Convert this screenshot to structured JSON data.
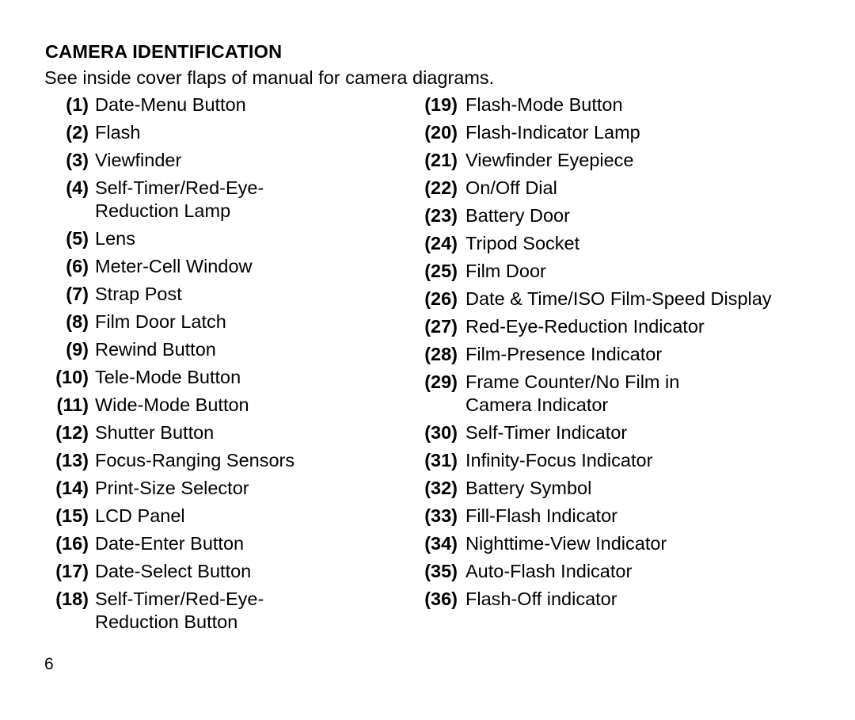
{
  "document": {
    "heading": "CAMERA IDENTIFICATION",
    "subtitle": "See inside cover flaps of manual for camera diagrams.",
    "page_number": "6",
    "text_color": "#000000",
    "background_color": "#ffffff"
  },
  "left_column": {
    "items": [
      {
        "number": "(1)",
        "label": "Date-Menu Button"
      },
      {
        "number": "(2)",
        "label": "Flash"
      },
      {
        "number": "(3)",
        "label": "Viewfinder"
      },
      {
        "number": "(4)",
        "label": "Self-Timer/Red-Eye-\nReduction Lamp"
      },
      {
        "number": "(5)",
        "label": "Lens"
      },
      {
        "number": "(6)",
        "label": "Meter-Cell Window"
      },
      {
        "number": "(7)",
        "label": "Strap Post"
      },
      {
        "number": "(8)",
        "label": "Film Door Latch"
      },
      {
        "number": "(9)",
        "label": "Rewind Button"
      },
      {
        "number": "(10)",
        "label": "Tele-Mode Button"
      },
      {
        "number": "(11)",
        "label": "Wide-Mode Button"
      },
      {
        "number": "(12)",
        "label": "Shutter Button"
      },
      {
        "number": "(13)",
        "label": "Focus-Ranging Sensors"
      },
      {
        "number": "(14)",
        "label": "Print-Size Selector"
      },
      {
        "number": "(15)",
        "label": "LCD Panel"
      },
      {
        "number": "(16)",
        "label": "Date-Enter Button"
      },
      {
        "number": "(17)",
        "label": "Date-Select Button"
      },
      {
        "number": "(18)",
        "label": "Self-Timer/Red-Eye-\nReduction Button"
      }
    ]
  },
  "right_column": {
    "items": [
      {
        "number": "(19)",
        "label": "Flash-Mode Button"
      },
      {
        "number": "(20)",
        "label": "Flash-Indicator Lamp"
      },
      {
        "number": "(21)",
        "label": "Viewfinder Eyepiece"
      },
      {
        "number": "(22)",
        "label": "On/Off Dial"
      },
      {
        "number": "(23)",
        "label": "Battery Door"
      },
      {
        "number": "(24)",
        "label": "Tripod Socket"
      },
      {
        "number": "(25)",
        "label": "Film Door"
      },
      {
        "number": "(26)",
        "label": "Date & Time/ISO Film-Speed Display"
      },
      {
        "number": "(27)",
        "label": "Red-Eye-Reduction Indicator"
      },
      {
        "number": "(28)",
        "label": "Film-Presence Indicator"
      },
      {
        "number": "(29)",
        "label": "Frame Counter/No Film in\nCamera Indicator"
      },
      {
        "number": "(30)",
        "label": "Self-Timer Indicator"
      },
      {
        "number": "(31)",
        "label": "Infinity-Focus Indicator"
      },
      {
        "number": "(32)",
        "label": "Battery Symbol"
      },
      {
        "number": "(33)",
        "label": "Fill-Flash Indicator"
      },
      {
        "number": "(34)",
        "label": "Nighttime-View Indicator"
      },
      {
        "number": "(35)",
        "label": "Auto-Flash Indicator"
      },
      {
        "number": "(36)",
        "label": "Flash-Off indicator"
      }
    ]
  }
}
